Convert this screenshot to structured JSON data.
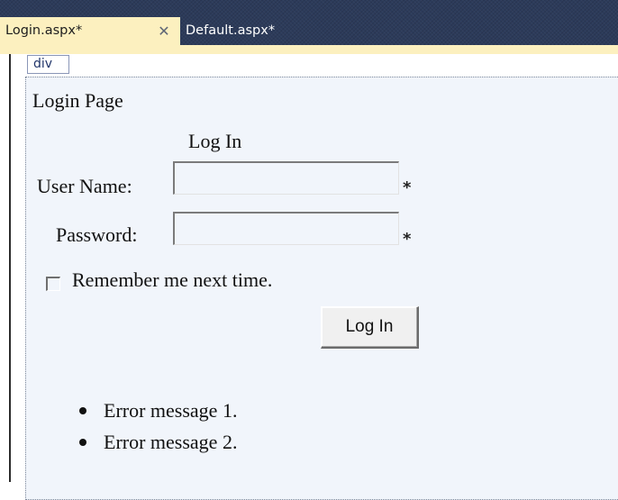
{
  "tabs": {
    "active": {
      "label": "Login.aspx*"
    },
    "inactive": {
      "label": "Default.aspx*"
    },
    "close_glyph": "✕"
  },
  "designer": {
    "div_tag": "div",
    "page_title": "Login Page",
    "login_title": "Log In",
    "username_label": "User Name:",
    "password_label": "Password:",
    "required_marker": "*",
    "remember_label": "Remember me next time.",
    "login_button": "Log In",
    "errors": [
      "Error message 1.",
      "Error message 2."
    ]
  },
  "colors": {
    "tabstrip_bg": "#2c3b5a",
    "active_tab_bg": "#fcf0bf",
    "surface_bg": "#f1f5fb"
  }
}
